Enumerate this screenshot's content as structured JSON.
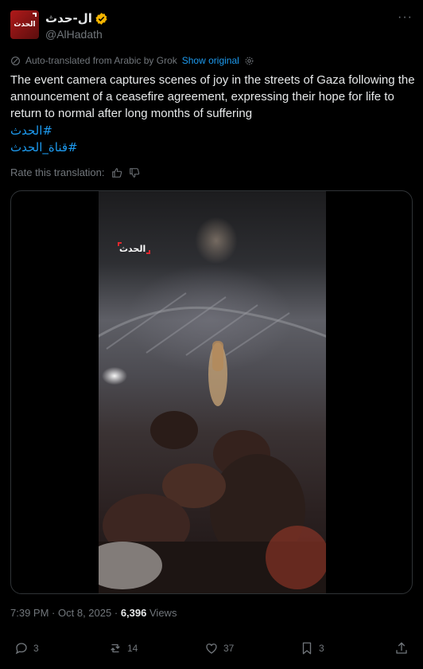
{
  "author": {
    "display_name": "ال-حدث",
    "handle": "@AlHadath",
    "avatar_text": "الحدث",
    "verified": true
  },
  "translation": {
    "notice": "Auto-translated from Arabic by Grok",
    "show_original": "Show original",
    "rate_label": "Rate this translation:"
  },
  "tweet": {
    "text": "The event camera captures scenes of joy in the streets of Gaza following the announcement of a ceasefire agreement, expressing their hope for life to return to normal after long months of suffering",
    "hashtags": [
      "#الحدث",
      "#قناة_الحدث"
    ]
  },
  "media": {
    "watermark": "الحدث"
  },
  "meta": {
    "time": "7:39 PM",
    "date": "Oct 8, 2025",
    "separator": "·",
    "views_count": "6,396",
    "views_label": "Views"
  },
  "actions": {
    "replies": "3",
    "reposts": "14",
    "likes": "37",
    "bookmarks": "3"
  },
  "colors": {
    "background": "#000000",
    "text": "#e7e9ea",
    "muted": "#71767b",
    "link": "#1d9bf0",
    "verified_badge": "#f4b400",
    "border": "#2f3336"
  },
  "icons": [
    "more-icon",
    "verified-icon",
    "translate-icon",
    "settings-icon",
    "thumbs-up-icon",
    "thumbs-down-icon",
    "reply-icon",
    "repost-icon",
    "like-icon",
    "bookmark-icon",
    "share-icon"
  ]
}
